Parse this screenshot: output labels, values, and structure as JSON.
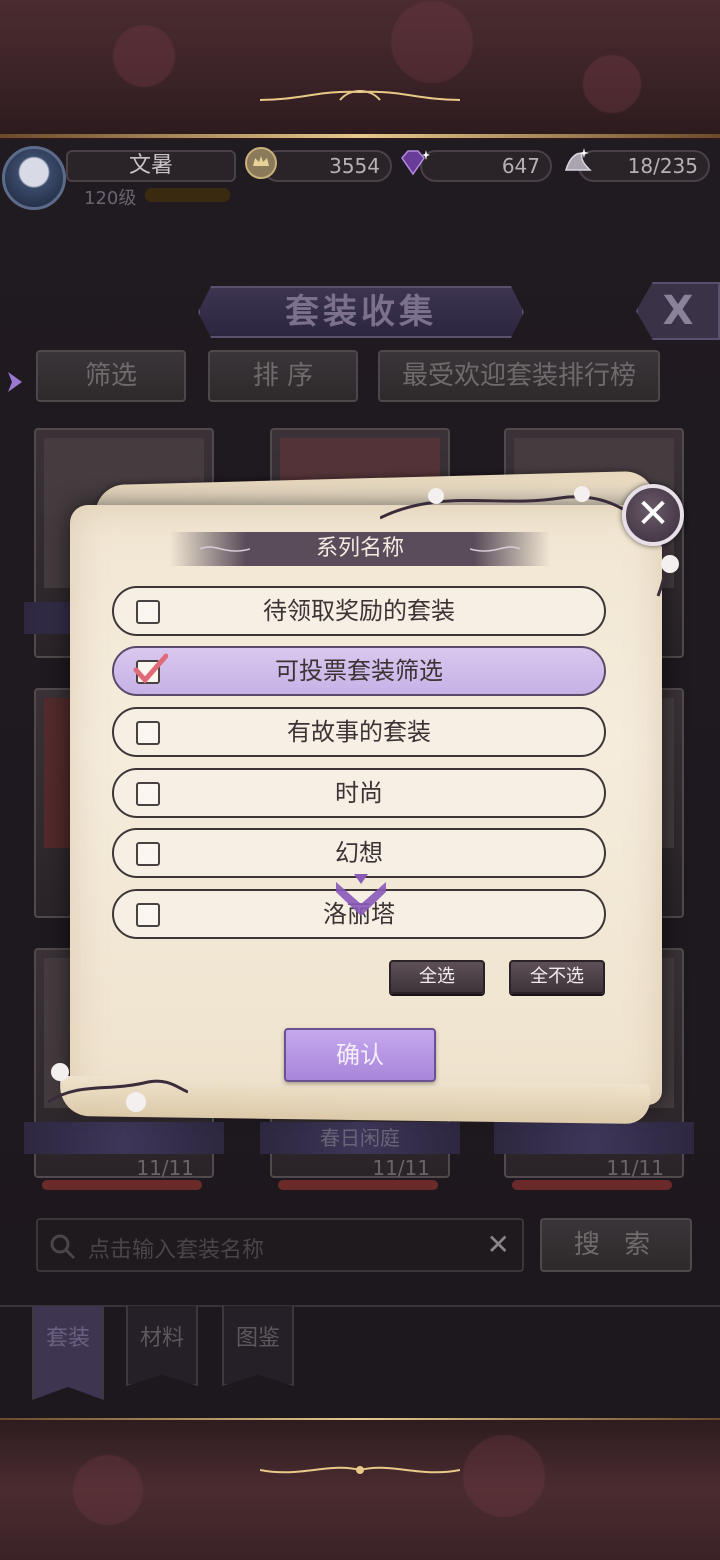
{
  "player": {
    "name": "文暑",
    "level": "120级"
  },
  "resources": {
    "gold": "3554",
    "diamond": "647",
    "stamina": "18/235"
  },
  "page": {
    "title": "套装收集",
    "close_label": "X"
  },
  "top_tabs": [
    {
      "label": "筛选"
    },
    {
      "label": "排 序"
    },
    {
      "label": "最受欢迎套装排行榜"
    }
  ],
  "cards": [
    {
      "name": "",
      "progress": "",
      "fraction": 1.0
    },
    {
      "name": "",
      "progress": "",
      "fraction": 1.0
    },
    {
      "name": "",
      "progress": "",
      "fraction": 1.0
    },
    {
      "name": "",
      "progress": "",
      "fraction": 1.0
    },
    {
      "name": "",
      "progress": "",
      "fraction": 1.0
    },
    {
      "name": "",
      "progress": "",
      "fraction": 1.0
    },
    {
      "name": "",
      "progress": "11/11",
      "fraction": 1.0
    },
    {
      "name": "春日闲庭",
      "progress": "11/11",
      "fraction": 1.0
    },
    {
      "name": "",
      "progress": "11/11",
      "fraction": 1.0
    }
  ],
  "search": {
    "placeholder": "点击输入套装名称",
    "clear": "✕",
    "button": "搜 索"
  },
  "bottom_tabs": [
    {
      "label": "套装",
      "active": true
    },
    {
      "label": "材料",
      "active": false
    },
    {
      "label": "图鉴",
      "active": false
    }
  ],
  "dialog": {
    "header": "系列名称",
    "close": "✕",
    "options": [
      {
        "label": "待领取奖励的套装",
        "checked": false
      },
      {
        "label": "可投票套装筛选",
        "checked": true
      },
      {
        "label": "有故事的套装",
        "checked": false
      },
      {
        "label": "时尚",
        "checked": false
      },
      {
        "label": "幻想",
        "checked": false
      },
      {
        "label": "洛丽塔",
        "checked": false
      }
    ],
    "select_all": "全选",
    "deselect_all": "全不选",
    "confirm": "确认"
  },
  "colors": {
    "accent_purple": "#c5a8ee",
    "selected_option": "#d9c8ef",
    "check_red": "#e06a7a",
    "gold": "#e8c98a"
  }
}
